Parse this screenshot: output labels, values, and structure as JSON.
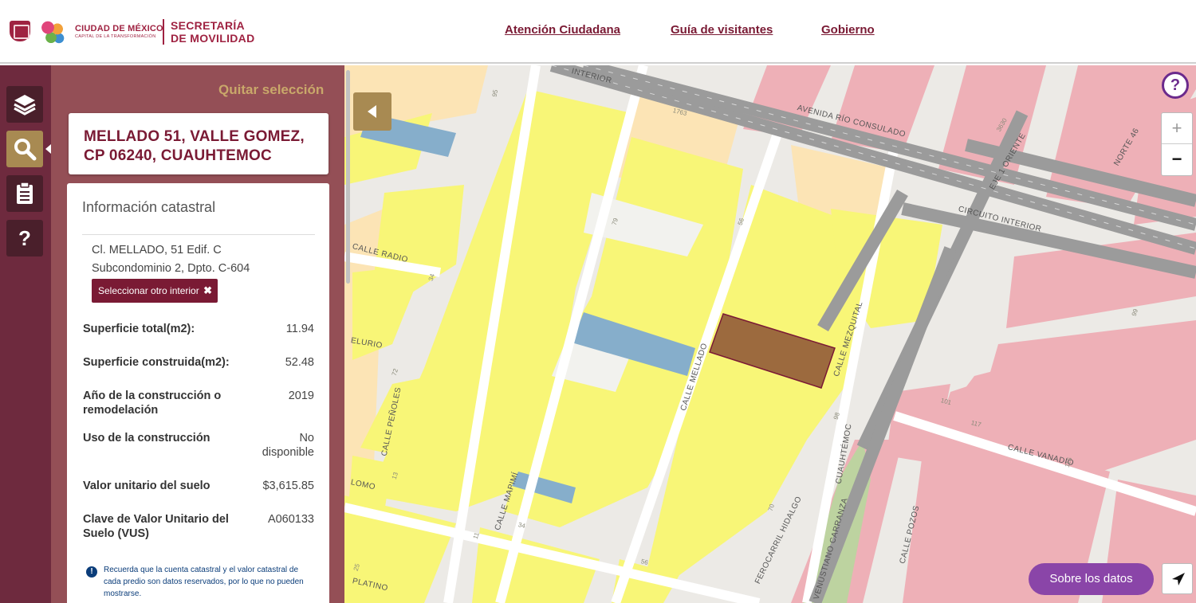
{
  "header": {
    "city_name": "CIUDAD DE MÉXICO",
    "city_tagline": "CAPITAL DE LA TRANSFORMACIÓN",
    "secretaria_line1": "SECRETARÍA",
    "secretaria_line2": "DE MOVILIDAD",
    "nav": [
      "Atención Ciudadana",
      "Guía de visitantes",
      "Gobierno"
    ]
  },
  "toolbar": {
    "tools": [
      {
        "icon": "layers-icon",
        "glyph": "≋"
      },
      {
        "icon": "search-icon",
        "glyph": "⚲"
      },
      {
        "icon": "clipboard-icon",
        "glyph": "▤"
      },
      {
        "icon": "help-icon",
        "glyph": "?"
      }
    ]
  },
  "panel": {
    "quitar": "Quitar selección",
    "address": "MELLADO 51, VALLE GOMEZ, CP 06240, CUAUHTEMOC",
    "info_title": "Información catastral",
    "interior_line1": "Cl. MELLADO, 51 Edif. C",
    "interior_line2": "Subcondominio 2, Dpto. C-604",
    "select_other": "Seleccionar otro interior",
    "close_x": "✖",
    "rows": [
      {
        "label": "Superficie total(m2):",
        "value": "11.94"
      },
      {
        "label": "Superficie construida(m2):",
        "value": "52.48"
      },
      {
        "label": "Año de la construcción o remodelación",
        "value": "2019"
      },
      {
        "label": "Uso de la construcción",
        "value": "No disponible"
      },
      {
        "label": "Valor unitario del suelo",
        "value": "$3,615.85"
      },
      {
        "label": "Clave de Valor Unitario del Suelo (VUS)",
        "value": "A060133"
      }
    ],
    "notice_icon": "!",
    "notice": "Recuerda que la cuenta catastral y el valor catastral de cada predio son datos reservados, por lo que no pueden mostrarse."
  },
  "map": {
    "help": "?",
    "zoom_in": "+",
    "zoom_out": "−",
    "sobre": "Sobre los datos",
    "streets": [
      "INTERIOR",
      "AVENIDA RÍO CONSULADO",
      "EJE 1 ORIENTE",
      "NORTE 46",
      "CIRCUITO INTERIOR",
      "CALLE RADIO",
      "ELURIO",
      "CALLE PEÑOLES",
      "CALLE MAPIMÍ",
      "CALLE MELLADO",
      "CALLE MEZQUITAL",
      "CALLE VANADIO",
      "CALLE POZOS",
      "CUAUHTÉMOC",
      "VENUSTIANO CARRANZA",
      "FEROCARRIL HIDALGO",
      "LOMO",
      "PLATINO"
    ],
    "lot_numbers": [
      "95",
      "1763",
      "3630",
      "79",
      "56",
      "34",
      "72",
      "13",
      "98",
      "99",
      "101",
      "117",
      "115",
      "70",
      "56",
      "25",
      "34",
      "11"
    ]
  }
}
